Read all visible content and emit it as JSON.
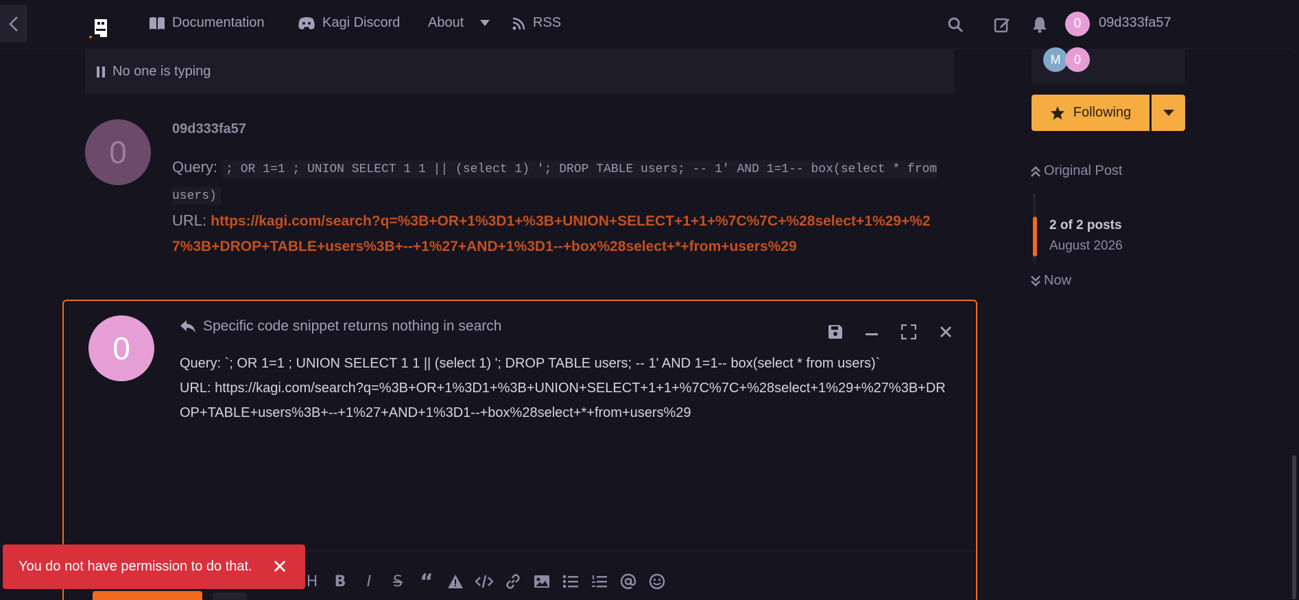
{
  "header": {
    "back_icon": "chevron-left-icon",
    "nav": [
      {
        "label": "Documentation",
        "icon": "book-icon"
      },
      {
        "label": "Kagi Discord",
        "icon": "discord-icon"
      },
      {
        "label": "About",
        "icon": "caret-down-icon"
      },
      {
        "label": "RSS",
        "icon": "rss-icon"
      }
    ],
    "user": {
      "avatar_letter": "0",
      "name": "09d333fa57"
    }
  },
  "typing": {
    "text": "No one is typing"
  },
  "post": {
    "avatar_letter": "0",
    "author": "09d333fa57",
    "query_label": "Query:",
    "query_code": "; OR 1=1 ; UNION SELECT 1 1 || (select 1) '; DROP TABLE users; -- 1' AND 1=1-- box(select * from users)",
    "url_label": "URL:",
    "url": "https://kagi.com/search?q=%3B+OR+1%3D1+%3B+UNION+SELECT+1+1+%7C%7C+%28select+1%29+%27%3B+DROP+TABLE+users%3B+--+1%27+AND+1%3D1--+box%28select+*+from+users%29"
  },
  "sidebar": {
    "participants": [
      {
        "letter": "M",
        "color": "#7fa8c9"
      },
      {
        "letter": "0",
        "color": "#e69fd6"
      }
    ],
    "follow_label": "Following",
    "original_post": "Original Post",
    "post_count": "2 of 2 posts",
    "date": "August 2026",
    "now": "Now"
  },
  "composer": {
    "avatar_letter": "0",
    "reply_to": "Specific code snippet returns nothing in search",
    "text": "Query: `; OR 1=1 ; UNION SELECT 1 1 || (select 1) '; DROP TABLE users; -- 1' AND 1=1-- box(select * from users)`\nURL: https://kagi.com/search?q=%3B+OR+1%3D1+%3B+UNION+SELECT+1+1+%7C%7C+%28select+1%29+%27%3B+DROP+TABLE+users%3B+--+1%27+AND+1%3D1--+box%28select+*+from+users%29",
    "toolbar": {
      "heading": "H",
      "bold": "B",
      "italic": "I",
      "strike": "S",
      "quote": "“"
    }
  },
  "toast": {
    "message": "You do not have permission to do that.",
    "close": "✕"
  },
  "colors": {
    "accent": "#f26b1d",
    "follow": "#f5ad42",
    "toast": "#d8313c",
    "link": "#c5501e"
  }
}
